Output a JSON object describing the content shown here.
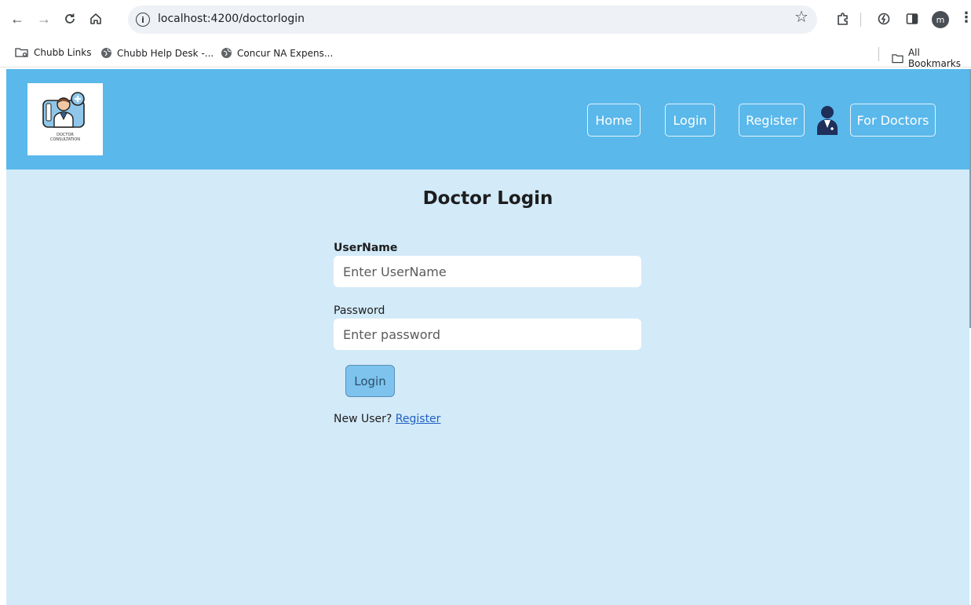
{
  "browser": {
    "url": "localhost:4200/doctorlogin",
    "profile_initial": "m",
    "bookmarks": [
      {
        "label": "Chubb Links",
        "icon": "folder-gear-icon"
      },
      {
        "label": "Chubb Help Desk -...",
        "icon": "globe-icon"
      },
      {
        "label": "Concur NA Expens...",
        "icon": "globe-icon"
      }
    ],
    "all_bookmarks_label": "All Bookmarks"
  },
  "header": {
    "logo_caption_line1": "DOCTOR",
    "logo_caption_line2": "CONSULTATION",
    "nav": {
      "home": "Home",
      "login": "Login",
      "register": "Register",
      "for_doctors": "For Doctors"
    },
    "background_color": "#5ab8eb"
  },
  "login_form": {
    "title": "Doctor Login",
    "username_label": "UserName",
    "username_placeholder": "Enter UserName",
    "password_label": "Password",
    "password_placeholder": "Enter password",
    "submit_label": "Login",
    "new_user_text": "New User?",
    "register_link": "Register"
  },
  "colors": {
    "page_background": "#d3eaf9",
    "button_background": "#7dc3ee",
    "link": "#1f5fc2"
  }
}
